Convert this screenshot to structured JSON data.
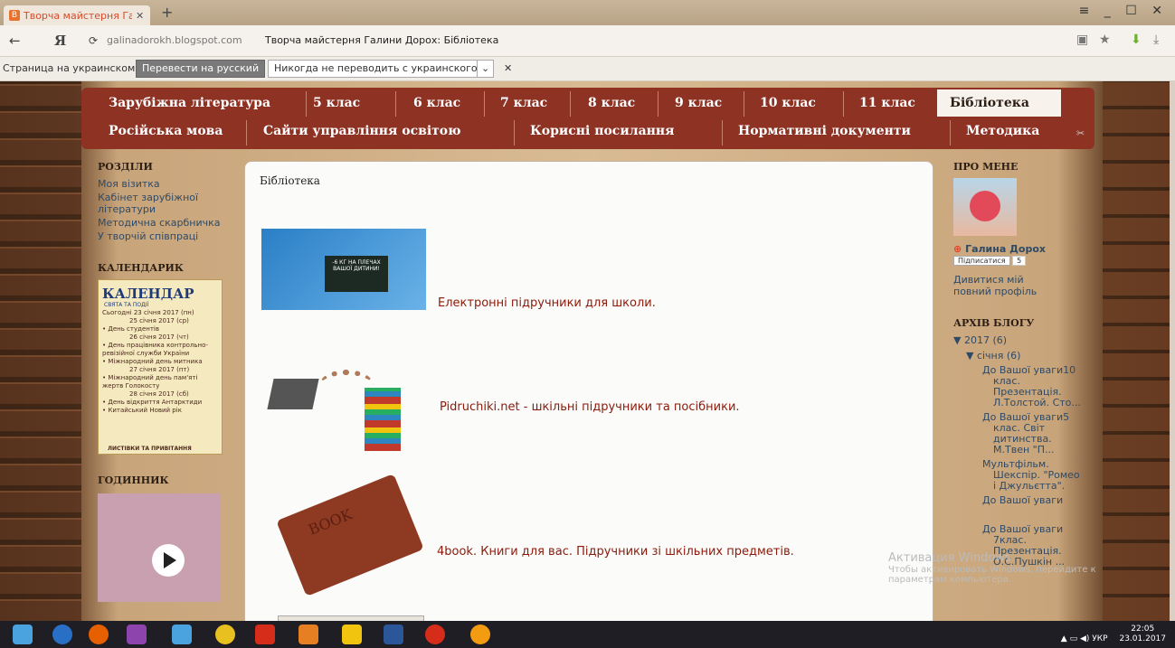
{
  "browser": {
    "tab_title": "Творча майстерня Гали...",
    "tab_close": "✕",
    "new_tab": "+",
    "back": "←",
    "yandex": "Я",
    "reload": "⟳",
    "domain": "galinadorokh.blogspot.com",
    "page_title": "Творча майстерня Галини Дорох: Бібліотека",
    "window_controls": "≡ _ ☐ ✕"
  },
  "translate": {
    "label": "Страница на украинском",
    "translate_button": "Перевести на русский",
    "never_button": "Никогда не переводить с украинского",
    "close": "✕"
  },
  "nav": {
    "row1": [
      "Зарубіжна література",
      "5 клас",
      "6 клас",
      "7 клас",
      "8 клас",
      "9 клас",
      "10 клас",
      "11 клас",
      "Бібліотека"
    ],
    "row2": [
      "Російська мова",
      "Сайти управління освітою",
      "Корисні посилання",
      "Нормативні документи",
      "Методика"
    ]
  },
  "left": {
    "sections_title": "РОЗДІЛИ",
    "links": [
      "Моя візитка",
      "Кабінет зарубіжної літератури",
      "Методична скарбничка",
      "У творчій співпраці"
    ],
    "calendar_title": "КАЛЕНДАРИК",
    "calendar": {
      "header": "КАЛЕНДАР",
      "subheader": "СВЯТА ТА ПОДІЇ",
      "lines": [
        "Сьогодні 23 січня 2017 (пн)",
        "25 січня 2017 (ср)",
        "• День студентів",
        "26 січня 2017 (чт)",
        "• День працівника контрольно-ревізійної служби України",
        "• Міжнародний день митника",
        "27 січня 2017 (пт)",
        "• Міжнародний день пам'яті жертв Голокосту",
        "28 січня 2017 (сб)",
        "• День відкриття Антарктиди",
        "• Китайський Новий рік"
      ],
      "footer": "ЛИСТІВКИ ТА ПРИВІТАННЯ"
    },
    "clock_title": "ГОДИННИК"
  },
  "main": {
    "title": "Бібліотека",
    "entries": [
      {
        "link": "Електронні підручники для школи.",
        "img_text": "-6 КГ НА ПЛЕЧАХ ВАШОЇ ДИТИНИ!"
      },
      {
        "link": "Pidruchiki.net - шкільні підручники та посібники."
      },
      {
        "link": "4book. Книги для вас. Підручники зі шкільних предметів.",
        "img_text": "BOOK"
      }
    ]
  },
  "right": {
    "about_title": "ПРО МЕНЕ",
    "author": "Галина Дорох",
    "subscribe": "Підписатися",
    "subscribe_count": "5",
    "profile_link": "Дивитися мій повний профіль",
    "archive_title": "АРХІВ БЛОГУ",
    "year": "▼ 2017 (6)",
    "month": "▼ січня (6)",
    "posts": [
      "До Вашої уваги10 клас. Презентація. Л.Толстой. Сто...",
      "До Вашої уваги5 клас. Світ дитинства. М.Твен \"П...",
      "Мультфільм. Шекспір. \"Ромео і Джульєтта\".",
      "До Вашої уваги",
      "До Вашої уваги 7клас. Презентація. О.С.Пушкін ..."
    ]
  },
  "watermark": {
    "title": "Активация Windows",
    "text": "Чтобы активировать Windows, перейдите к параметрам компьютера."
  },
  "taskbar": {
    "lang": "УКР",
    "time": "22:05",
    "date": "23.01.2017"
  }
}
